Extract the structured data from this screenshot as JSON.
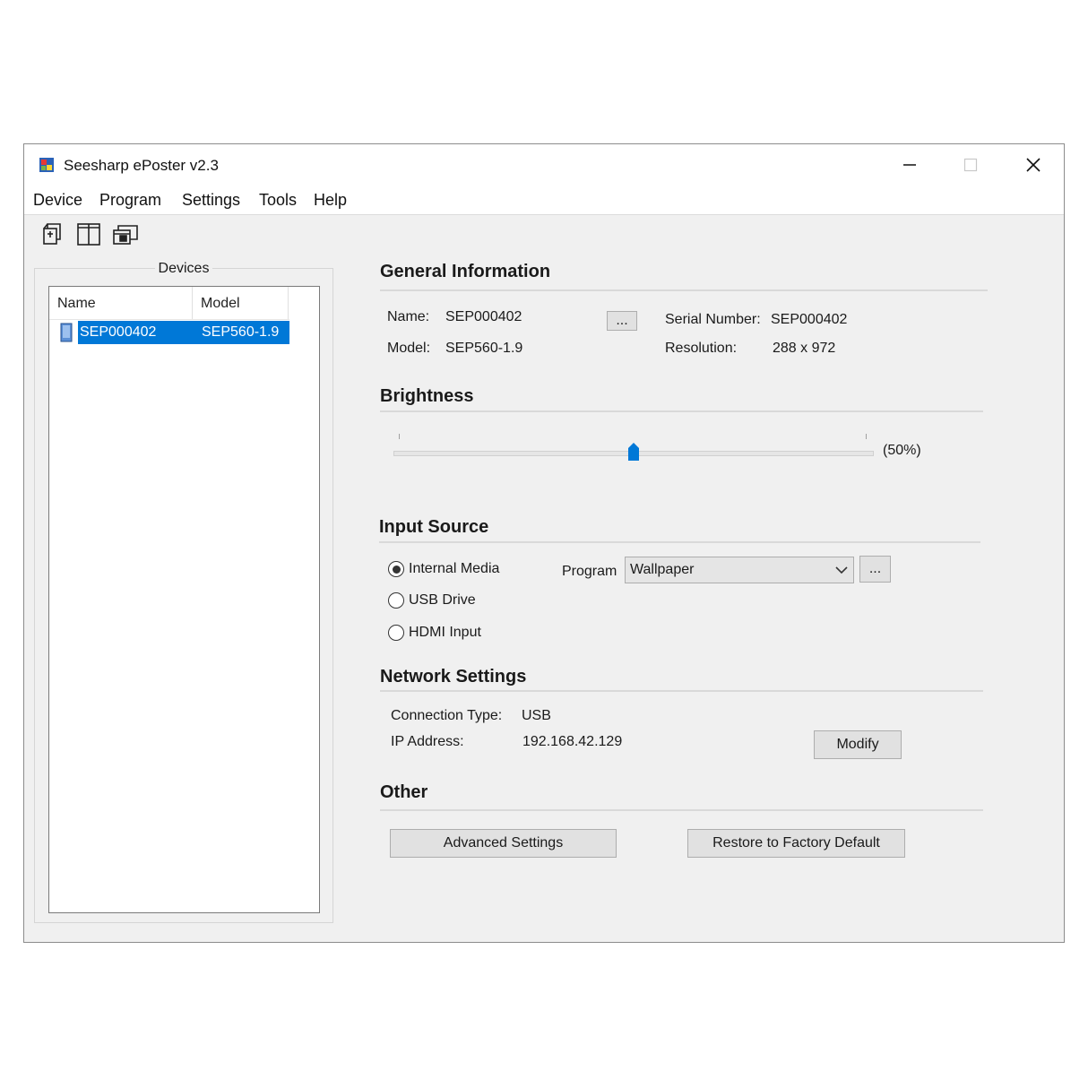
{
  "window": {
    "title": "Seesharp ePoster v2.3",
    "controls": {
      "minimize": "minimize-icon",
      "maximize": "maximize-icon",
      "close": "close-icon"
    }
  },
  "menu": [
    "Device",
    "Program",
    "Settings",
    "Tools",
    "Help"
  ],
  "toolbar": [
    "device-icon",
    "split-panel-icon",
    "windows-icon"
  ],
  "devices": {
    "title": "Devices",
    "columns": [
      "Name",
      "Model"
    ],
    "rows": [
      {
        "name": "SEP000402",
        "model": "SEP560-1.9",
        "selected": true
      }
    ]
  },
  "general": {
    "title": "General Information",
    "name_label": "Name:",
    "name_value": "SEP000402",
    "model_label": "Model:",
    "model_value": "SEP560-1.9",
    "edit_button": "...",
    "serial_label": "Serial Number:",
    "serial_value": "SEP000402",
    "resolution_label": "Resolution:",
    "resolution_value": "288 x 972"
  },
  "brightness": {
    "title": "Brightness",
    "value_percent": 50,
    "value_text": "(50%)"
  },
  "input_source": {
    "title": "Input Source",
    "options": [
      "Internal Media",
      "USB Drive",
      "HDMI Input"
    ],
    "selected": "Internal Media",
    "program_label": "Program",
    "program_value": "Wallpaper",
    "program_button": "..."
  },
  "network": {
    "title": "Network Settings",
    "connection_label": "Connection Type:",
    "connection_value": "USB",
    "ip_label": "IP Address:",
    "ip_value": "192.168.42.129",
    "modify_button": "Modify"
  },
  "other": {
    "title": "Other",
    "advanced_button": "Advanced Settings",
    "restore_button": "Restore to Factory Default"
  },
  "colors": {
    "accent": "#0078d7",
    "background": "#f0f0f0"
  }
}
